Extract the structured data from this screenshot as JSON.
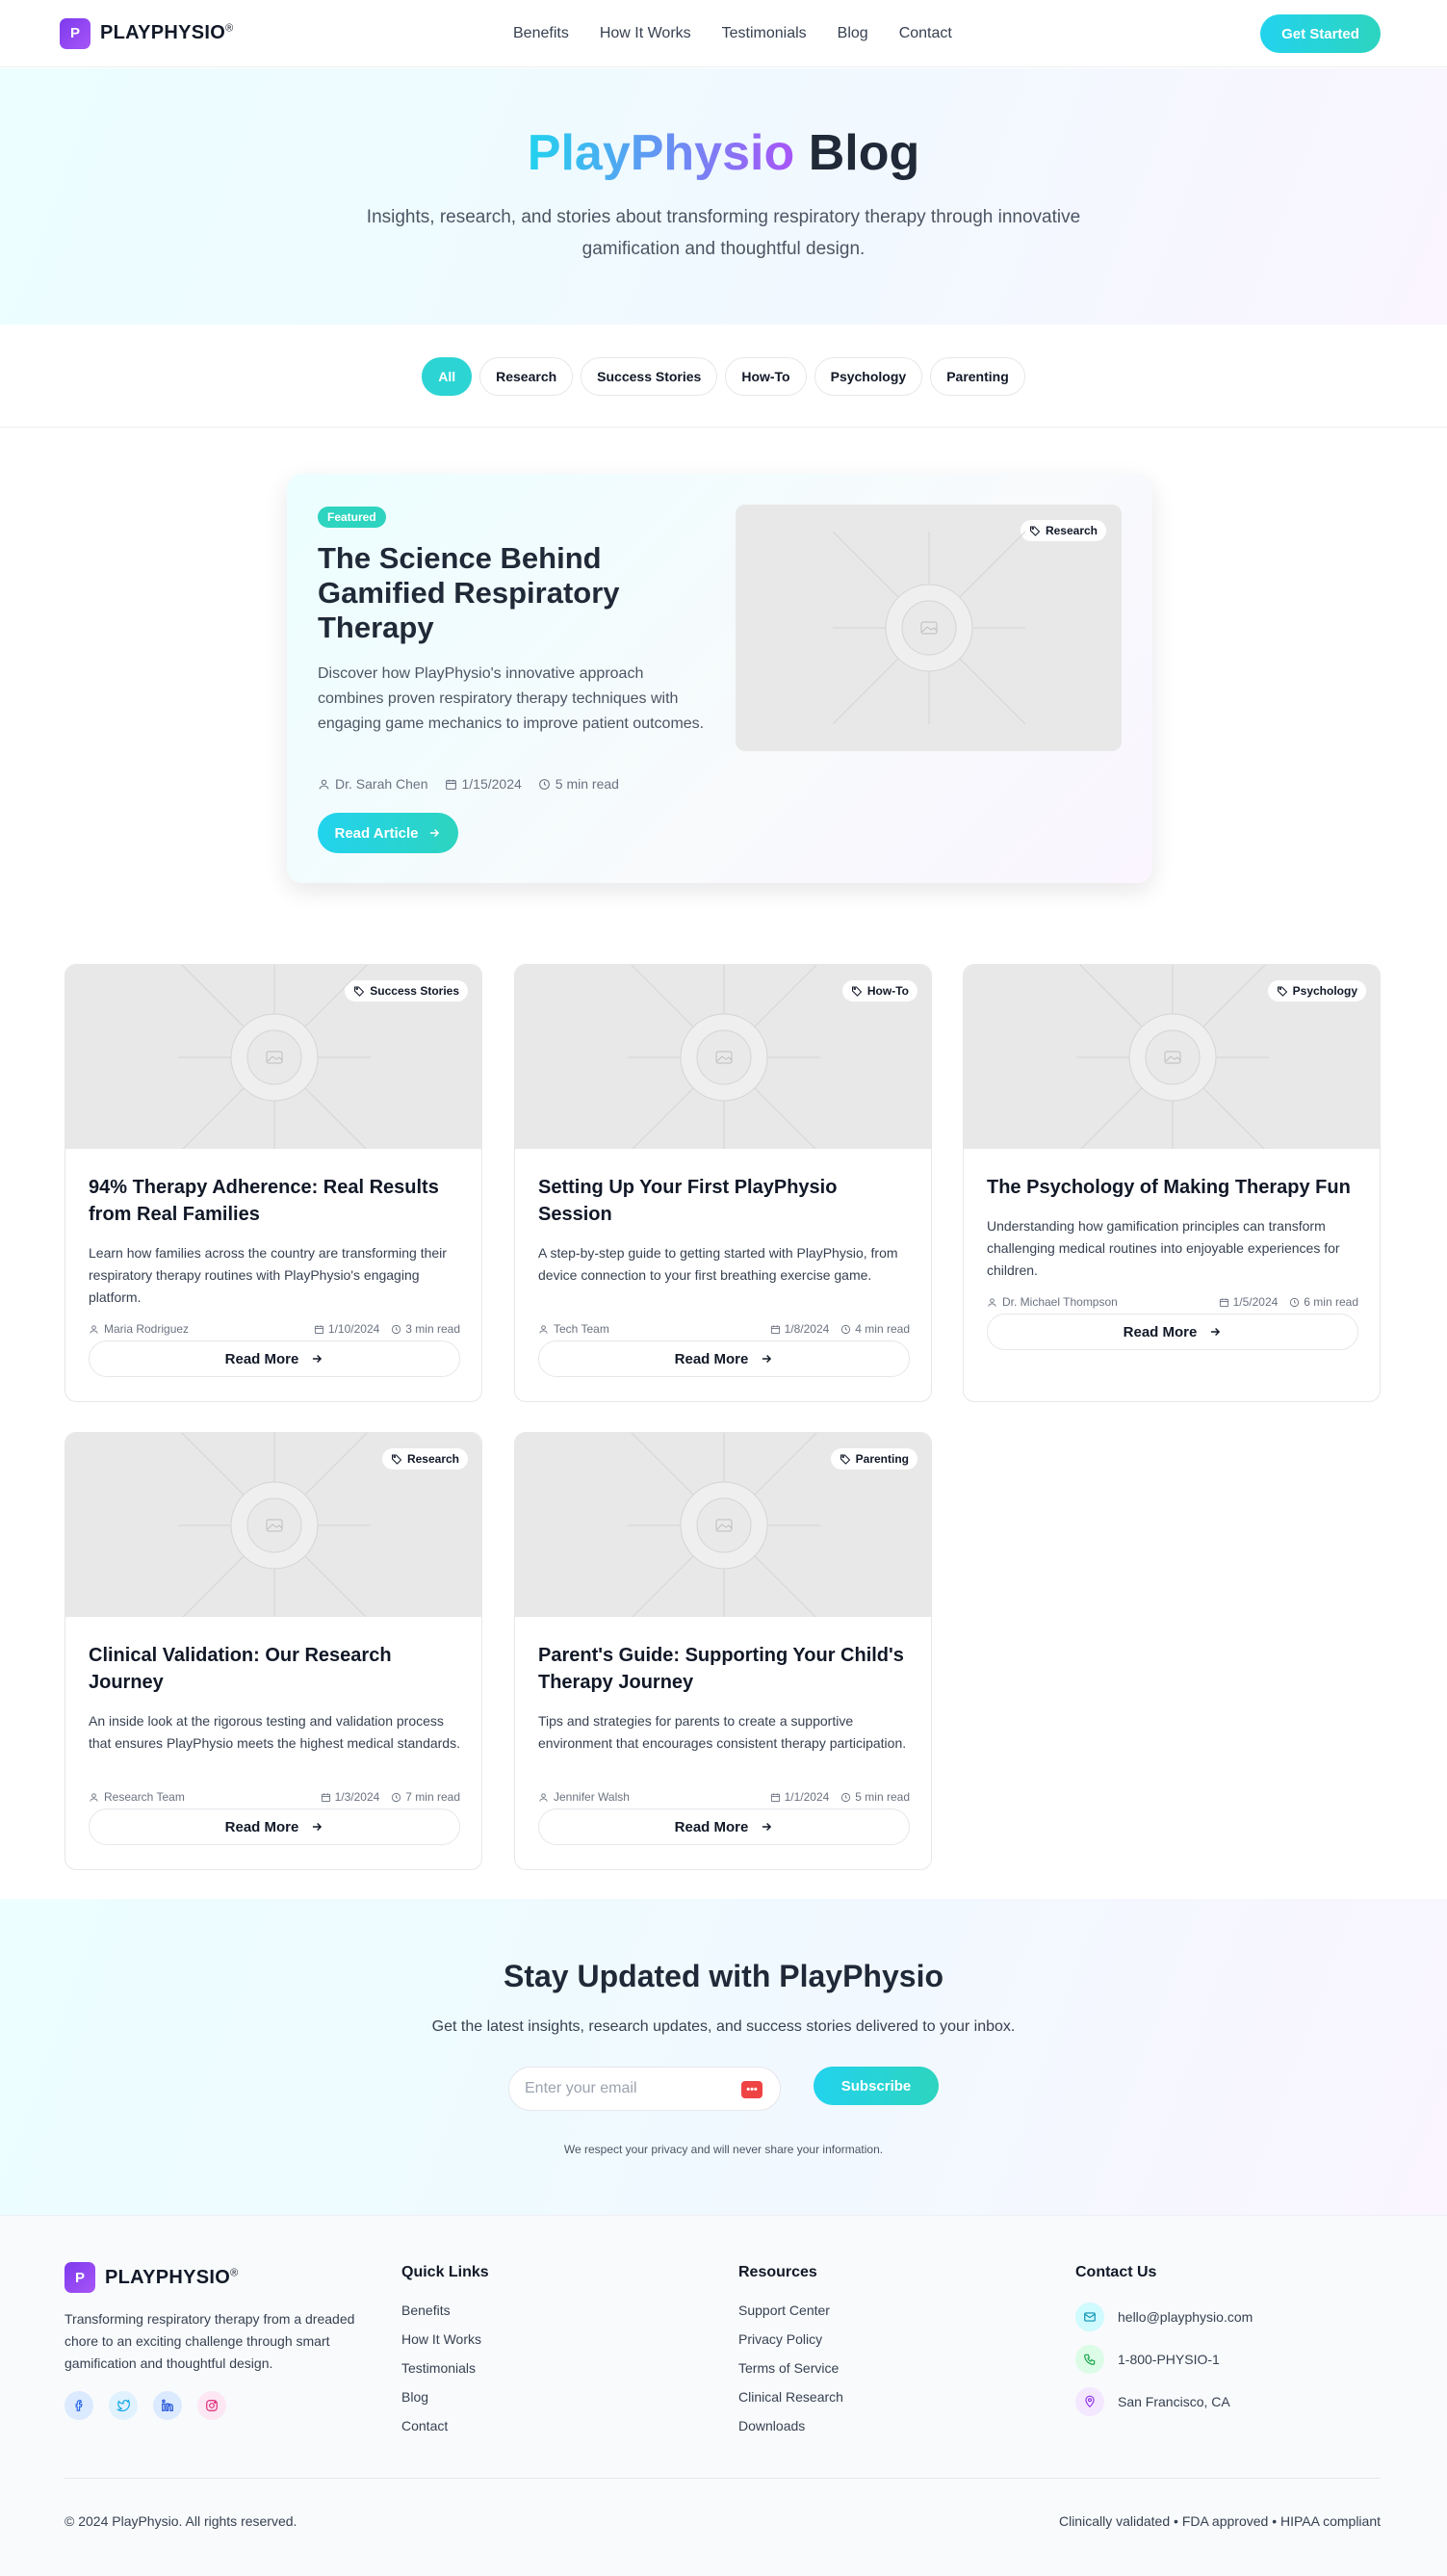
{
  "brand": {
    "logo_letter": "P",
    "name": "PLAYPHYSIO",
    "mark": "®",
    "accent": "#22d3ee",
    "purple": "#a855f7"
  },
  "nav": {
    "links": [
      "Benefits",
      "How It Works",
      "Testimonials",
      "Blog",
      "Contact"
    ],
    "cta": "Get Started"
  },
  "hero": {
    "title_brand": "PlayPhysio",
    "title_rest": "Blog",
    "subtitle": "Insights, research, and stories about transforming respiratory therapy through innovative gamification and thoughtful design."
  },
  "filters": {
    "active": "All",
    "items": [
      "All",
      "Research",
      "Success Stories",
      "How-To",
      "Psychology",
      "Parenting"
    ]
  },
  "featured": {
    "badge": "Featured",
    "title": "The Science Behind Gamified Respiratory Therapy",
    "description": "Discover how PlayPhysio's innovative approach combines proven respiratory therapy techniques with engaging game mechanics to improve patient outcomes.",
    "author": "Dr. Sarah Chen",
    "date": "1/15/2024",
    "read_time": "5 min read",
    "button": "Read Article",
    "tag": "Research",
    "image_icon": "image-icon"
  },
  "posts": [
    {
      "tag": "Success Stories",
      "title": "94% Therapy Adherence: Real Results from Real Families",
      "description": "Learn how families across the country are transforming their respiratory therapy routines with PlayPhysio's engaging platform.",
      "author": "Maria Rodriguez",
      "date": "1/10/2024",
      "read_time": "3 min read",
      "button": "Read More"
    },
    {
      "tag": "How-To",
      "title": "Setting Up Your First PlayPhysio Session",
      "description": "A step-by-step guide to getting started with PlayPhysio, from device connection to your first breathing exercise game.",
      "author": "Tech Team",
      "date": "1/8/2024",
      "read_time": "4 min read",
      "button": "Read More"
    },
    {
      "tag": "Psychology",
      "title": "The Psychology of Making Therapy Fun",
      "description": "Understanding how gamification principles can transform challenging medical routines into enjoyable experiences for children.",
      "author": "Dr. Michael Thompson",
      "date": "1/5/2024",
      "read_time": "6 min read",
      "button": "Read More"
    },
    {
      "tag": "Research",
      "title": "Clinical Validation: Our Research Journey",
      "description": "An inside look at the rigorous testing and validation process that ensures PlayPhysio meets the highest medical standards.",
      "author": "Research Team",
      "date": "1/3/2024",
      "read_time": "7 min read",
      "button": "Read More"
    },
    {
      "tag": "Parenting",
      "title": "Parent's Guide: Supporting Your Child's Therapy Journey",
      "description": "Tips and strategies for parents to create a supportive environment that encourages consistent therapy participation.",
      "author": "Jennifer Walsh",
      "date": "1/1/2024",
      "read_time": "5 min read",
      "button": "Read More"
    }
  ],
  "newsletter": {
    "title": "Stay Updated with PlayPhysio",
    "subtitle": "Get the latest insights, research updates, and success stories delivered to your inbox.",
    "placeholder": "Enter your email",
    "button": "Subscribe",
    "privacy": "We respect your privacy and will never share your information."
  },
  "footer": {
    "description": "Transforming respiratory therapy from a dreaded chore to an exciting challenge through smart gamification and thoughtful design.",
    "socials": [
      "facebook-icon",
      "twitter-icon",
      "linkedin-icon",
      "instagram-icon"
    ],
    "quick_links": {
      "title": "Quick Links",
      "items": [
        "Benefits",
        "How It Works",
        "Testimonials",
        "Blog",
        "Contact"
      ]
    },
    "resources": {
      "title": "Resources",
      "items": [
        "Support Center",
        "Privacy Policy",
        "Terms of Service",
        "Clinical Research",
        "Downloads"
      ]
    },
    "contact": {
      "title": "Contact Us",
      "email": "hello@playphysio.com",
      "phone": "1-800-PHYSIO-1",
      "location": "San Francisco, CA"
    },
    "copyright": "© 2024 PlayPhysio. All rights reserved.",
    "compliance": "Clinically validated • FDA approved • HIPAA compliant"
  }
}
